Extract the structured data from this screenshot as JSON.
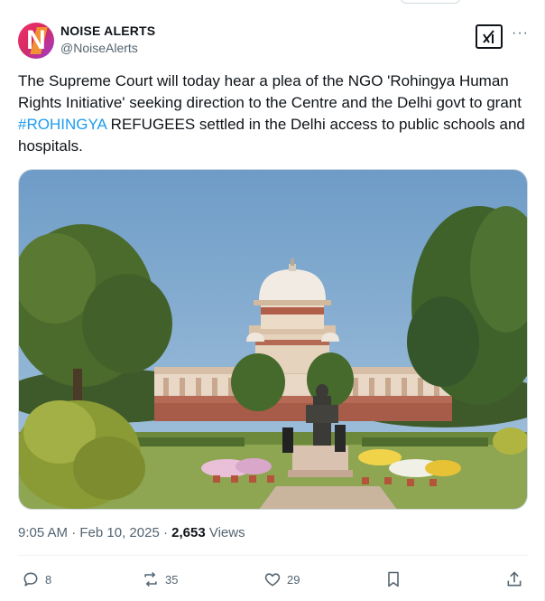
{
  "author": {
    "display_name": "NOISE ALERTS",
    "handle": "@NoiseAlerts",
    "avatar_letter": "N",
    "avatar_colors": [
      "#f2316b",
      "#9b3bd3",
      "#f7a227"
    ]
  },
  "header": {
    "grok_icon": "grok-icon",
    "more_label": "···"
  },
  "tweet": {
    "text_before": "The Supreme Court will today hear a plea of the NGO  'Rohingya Human Rights Initiative' seeking direction to the Centre and the Delhi govt to grant ",
    "hashtag": "#ROHINGYA",
    "text_after": " REFUGEES settled in the Delhi access to public schools and hospitals.",
    "hashtag_color": "#1d9bf0"
  },
  "media": {
    "subject": "photo-supreme-court-building"
  },
  "meta": {
    "time": "9:05 AM",
    "separator": "·",
    "date": "Feb 10, 2025",
    "views_count": "2,653",
    "views_label": "Views"
  },
  "actions": {
    "replies": "8",
    "reposts": "35",
    "likes": "29",
    "reply_icon": "reply-icon",
    "repost_icon": "repost-icon",
    "like_icon": "heart-icon",
    "bookmark_icon": "bookmark-icon",
    "share_icon": "share-icon"
  },
  "colors": {
    "text_primary": "#0f1419",
    "text_secondary": "#536471",
    "accent": "#1d9bf0",
    "border": "#cfd9de"
  }
}
